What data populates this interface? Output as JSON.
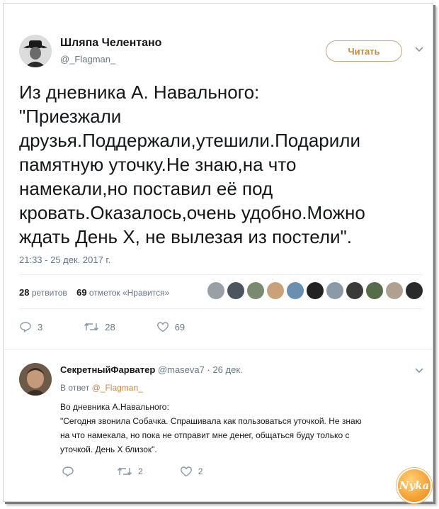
{
  "tweet": {
    "author_name": "Шляпа Челентано",
    "author_handle": "@_Flagman_",
    "follow_label": "Читать",
    "text_lines": [
      "Из дневника А. Навального:",
      "\"Приезжали",
      "друзья.Поддержали,утешили.Подарили",
      "памятную уточку.Не знаю,на что",
      "намекали,но поставил её под",
      "кровать.Оказалось,очень удобно.Можно",
      "ждать День Х, не вылезая из постели\"."
    ],
    "timestamp": "21:33 - 25 дек. 2017 г.",
    "retweets_count": "28",
    "retweets_label": "ретвитов",
    "likes_count": "69",
    "likes_label": "отметок «Нравится»",
    "liker_colors": [
      "#9aa0a6",
      "#4a5560",
      "#7a8a70",
      "#c9a27a",
      "#6a8fb0",
      "#222222",
      "#8a9aa8",
      "#3a3a3a",
      "#556b4a",
      "#b0a090",
      "#2a2a2a"
    ],
    "actions": {
      "reply_count": "3",
      "retweet_count": "28",
      "like_count": "69"
    }
  },
  "reply": {
    "author_name": "СекретныйФарватер",
    "author_handle": "@maseva7",
    "date": "· 26 дек.",
    "in_reply_prefix": "В ответ",
    "in_reply_handle": "@_Flagman_",
    "text_lines": [
      "Во дневника А.Навального:",
      "\"Сегодня звонила Собачка. Спрашивала как пользоваться уточкой. Не знаю",
      "на что намекала, но пока не отправит мне денег, общаться буду только с",
      "уточкой. День Х близок\"."
    ],
    "actions": {
      "reply_count": "",
      "retweet_count": "2",
      "like_count": "2"
    }
  },
  "watermark": "Nyka",
  "colors": {
    "accent": "#c08a45",
    "muted": "#657786",
    "icon": "#8899a6"
  }
}
